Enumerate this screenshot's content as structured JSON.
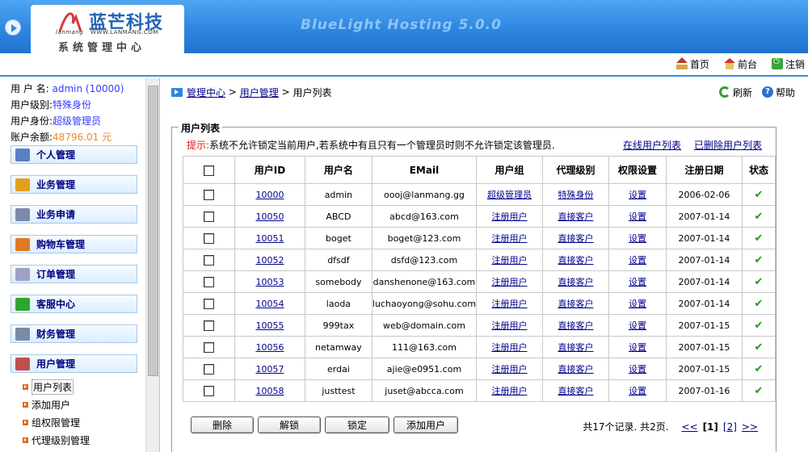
{
  "header": {
    "logo_cn": "蓝芒科技",
    "logo_en": "lanmang",
    "logo_url": "WWW.LANMANG.COM",
    "logo_sub": "系统管理中心",
    "brand": "BlueLight Hosting 5.0.0"
  },
  "toplinks": [
    {
      "label": "首页",
      "icon": "home-icon"
    },
    {
      "label": "前台",
      "icon": "house-icon"
    },
    {
      "label": "注销",
      "icon": "logout-icon"
    }
  ],
  "userinfo": {
    "name_label": "用 户 名:",
    "name_value": "admin (10000)",
    "level_label": "用户级别:",
    "level_value": "特殊身份",
    "role_label": "用户身份:",
    "role_value": "超级管理员",
    "balance_label": "账户余额:",
    "balance_value": "48796.01 元"
  },
  "menu": [
    {
      "label": "个人管理",
      "icon": "person-icon",
      "color": "#5a7fc4"
    },
    {
      "label": "业务管理",
      "icon": "box-icon",
      "color": "#e0a020"
    },
    {
      "label": "业务申请",
      "icon": "wrench-icon",
      "color": "#7a8aa8"
    },
    {
      "label": "购物车管理",
      "icon": "cart-icon",
      "color": "#e07a20"
    },
    {
      "label": "订单管理",
      "icon": "order-icon",
      "color": "#a0a0c8"
    },
    {
      "label": "客服中心",
      "icon": "checkmark-icon",
      "color": "#2ea52e"
    },
    {
      "label": "财务管理",
      "icon": "finance-icon",
      "color": "#7a8aa8"
    },
    {
      "label": "用户管理",
      "icon": "users-icon",
      "color": "#c05050"
    }
  ],
  "submenu": [
    {
      "label": "用户列表"
    },
    {
      "label": "添加用户"
    },
    {
      "label": "组权限管理"
    },
    {
      "label": "代理级别管理"
    }
  ],
  "breadcrumb": {
    "root": "管理中心",
    "sep1": ">",
    "mid": "用户管理",
    "sep2": ">",
    "current": "用户列表"
  },
  "actions": {
    "refresh": "刷新",
    "help": "帮助"
  },
  "panel": {
    "title": "用户列表",
    "tip_label": "提示:",
    "tip_text": "系统不允许锁定当前用户,若系统中有且只有一个管理员时则不允许锁定该管理员.",
    "link_online": "在线用户列表",
    "link_deleted": "已删除用户列表"
  },
  "table": {
    "headers": [
      "用户ID",
      "用户名",
      "EMail",
      "用户组",
      "代理级别",
      "权限设置",
      "注册日期",
      "状态"
    ],
    "rows": [
      {
        "id": "10000",
        "name": "admin",
        "email": "oooj@lanmang.gg",
        "group": "超级管理员",
        "agent": "特殊身份",
        "perm": "设置",
        "date": "2006-02-06"
      },
      {
        "id": "10050",
        "name": "ABCD",
        "email": "abcd@163.com",
        "group": "注册用户",
        "agent": "直接客户",
        "perm": "设置",
        "date": "2007-01-14"
      },
      {
        "id": "10051",
        "name": "boget",
        "email": "boget@123.com",
        "group": "注册用户",
        "agent": "直接客户",
        "perm": "设置",
        "date": "2007-01-14"
      },
      {
        "id": "10052",
        "name": "dfsdf",
        "email": "dsfd@123.com",
        "group": "注册用户",
        "agent": "直接客户",
        "perm": "设置",
        "date": "2007-01-14"
      },
      {
        "id": "10053",
        "name": "somebody",
        "email": "danshenone@163.com",
        "group": "注册用户",
        "agent": "直接客户",
        "perm": "设置",
        "date": "2007-01-14"
      },
      {
        "id": "10054",
        "name": "laoda",
        "email": "luchaoyong@sohu.com",
        "group": "注册用户",
        "agent": "直接客户",
        "perm": "设置",
        "date": "2007-01-14"
      },
      {
        "id": "10055",
        "name": "999tax",
        "email": "web@domain.com",
        "group": "注册用户",
        "agent": "直接客户",
        "perm": "设置",
        "date": "2007-01-15"
      },
      {
        "id": "10056",
        "name": "netamway",
        "email": "111@163.com",
        "group": "注册用户",
        "agent": "直接客户",
        "perm": "设置",
        "date": "2007-01-15"
      },
      {
        "id": "10057",
        "name": "erdai",
        "email": "ajie@e0951.com",
        "group": "注册用户",
        "agent": "直接客户",
        "perm": "设置",
        "date": "2007-01-15"
      },
      {
        "id": "10058",
        "name": "justtest",
        "email": "juset@abcca.com",
        "group": "注册用户",
        "agent": "直接客户",
        "perm": "设置",
        "date": "2007-01-16"
      }
    ]
  },
  "buttons": [
    "删除",
    "解锁",
    "锁定",
    "添加用户"
  ],
  "pager": {
    "summary": "共17个记录. 共2页.",
    "prev": "<<",
    "pages": [
      "[1]",
      "[2]"
    ],
    "next": ">>"
  }
}
